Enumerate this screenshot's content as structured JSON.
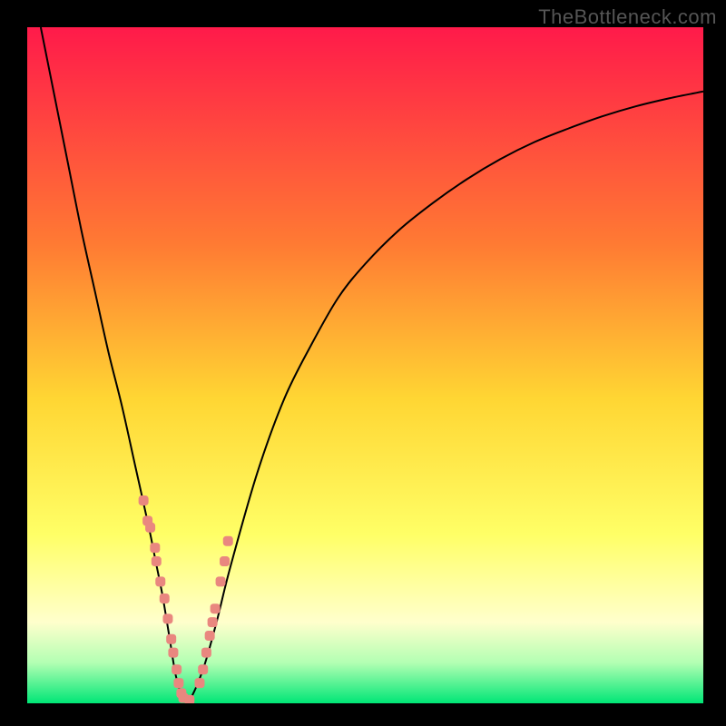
{
  "watermark": "TheBottleneck.com",
  "colors": {
    "frame_bg": "#000000",
    "grad_top": "#ff1a4a",
    "grad_mid_upper": "#ff7a33",
    "grad_mid": "#ffd633",
    "grad_mid_lower": "#ffff66",
    "grad_pale_yellow": "#ffffcc",
    "grad_light_green": "#b3ffb3",
    "grad_green": "#00e676",
    "curve": "#000000",
    "marker_fill": "#e9877f",
    "marker_stroke": "#c76a63"
  },
  "chart_data": {
    "type": "line",
    "title": "",
    "xlabel": "",
    "ylabel": "",
    "xlim": [
      0,
      100
    ],
    "ylim": [
      0,
      100
    ],
    "grid": false,
    "series": [
      {
        "name": "curve",
        "x": [
          2,
          4,
          6,
          8,
          10,
          12,
          14,
          16,
          18,
          19,
          20,
          21,
          22,
          23,
          24,
          26,
          28,
          30,
          34,
          38,
          42,
          46,
          50,
          55,
          60,
          65,
          70,
          75,
          80,
          85,
          90,
          95,
          100
        ],
        "y": [
          100,
          90,
          80,
          70,
          61,
          52,
          44,
          35,
          26,
          21,
          16,
          10,
          4,
          1,
          0.5,
          5,
          12,
          20,
          34,
          45,
          53,
          60,
          65,
          70,
          74,
          77.5,
          80.5,
          83,
          85,
          86.8,
          88.3,
          89.5,
          90.5
        ]
      }
    ],
    "markers": {
      "name": "highlight-dots",
      "x": [
        17.2,
        17.8,
        18.2,
        18.9,
        19.1,
        19.7,
        20.3,
        20.8,
        21.3,
        21.6,
        22.1,
        22.4,
        22.8,
        23.1,
        24.0,
        25.5,
        26.0,
        26.5,
        27.0,
        27.4,
        27.8,
        28.6,
        29.2,
        29.7
      ],
      "y": [
        30,
        27,
        26,
        23,
        21,
        18,
        15.5,
        12.5,
        9.5,
        7.5,
        5,
        3,
        1.5,
        0.8,
        0.5,
        3,
        5,
        7.5,
        10,
        12,
        14,
        18,
        21,
        24
      ]
    },
    "gradient_stops": [
      {
        "offset": 0.0,
        "key": "grad_top"
      },
      {
        "offset": 0.32,
        "key": "grad_mid_upper"
      },
      {
        "offset": 0.55,
        "key": "grad_mid"
      },
      {
        "offset": 0.75,
        "key": "grad_mid_lower"
      },
      {
        "offset": 0.88,
        "key": "grad_pale_yellow"
      },
      {
        "offset": 0.94,
        "key": "grad_light_green"
      },
      {
        "offset": 1.0,
        "key": "grad_green"
      }
    ]
  }
}
